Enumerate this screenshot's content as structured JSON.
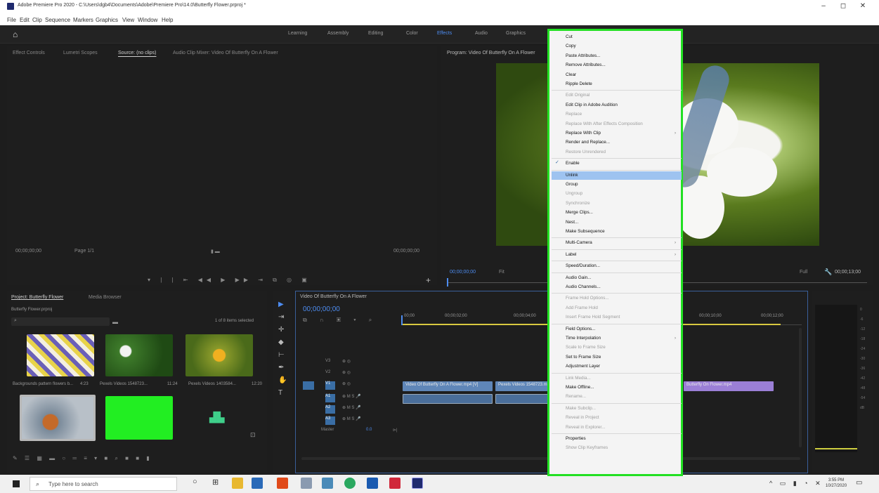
{
  "window": {
    "title": "Adobe Premiere Pro 2020 - C:\\Users\\dgb4\\Documents\\Adobe\\Premiere Pro\\14.0\\Butterfly Flower.prproj *",
    "minimize": "–",
    "maximize": "◻",
    "close": "✕"
  },
  "menubar": [
    "File",
    "Edit",
    "Clip",
    "Sequence",
    "Markers",
    "Graphics",
    "View",
    "Window",
    "Help"
  ],
  "workspaces": [
    "Learning",
    "Assembly",
    "Editing",
    "Color",
    "Effects",
    "Audio",
    "Graphics"
  ],
  "source_monitor": {
    "tabs": [
      "Effect Controls",
      "Lumetri Scopes",
      "Source: (no clips)",
      "Audio Clip Mixer: Video Of Butterfly On A Flower"
    ],
    "timecode_in": "00;00;00;00",
    "timecode_out": "00;00;00;00",
    "fit": "Page 1/1"
  },
  "program_monitor": {
    "title": "Program: Video Of Butterfly On A Flower",
    "timecode": "00;00;00;00",
    "duration": "00;00;13;00",
    "fit": "Fit",
    "zoom": "Full"
  },
  "project_panel": {
    "title": "Project: Butterfly Flower",
    "tab2": "Media Browser",
    "bin": "Butterfly Flower.prproj",
    "selection": "1 of 8 items selected",
    "items": [
      {
        "label": "Backgrounds pattern flowers b...",
        "duration": "4:23"
      },
      {
        "label": "Pexels Videos 1548723...",
        "duration": "11:24"
      },
      {
        "label": "Pexels Videos 1403584...",
        "duration": "12:20"
      }
    ]
  },
  "timeline": {
    "title": "Video Of Butterfly On A Flower",
    "timecode": "00;00;00;00",
    "ruler": [
      "00;00",
      "00;00;02;00",
      "00;00;04;00",
      "00;00;10;00",
      "00;00;12;00"
    ],
    "tracks": [
      "V3",
      "V2",
      "V1",
      "A1",
      "A2",
      "A3"
    ],
    "master": "Master",
    "master_value": "0.0",
    "clips": {
      "v1a": "Video Of Butterfly On A Flower.mp4 [V]",
      "v1b": "Pexels Videos 1548723.mp4",
      "v1c": "Butterfly On Flower.mp4"
    }
  },
  "context_menu": {
    "items": [
      {
        "label": "Cut",
        "state": "enabled"
      },
      {
        "label": "Copy",
        "state": "enabled"
      },
      {
        "label": "Paste Attributes...",
        "state": "enabled"
      },
      {
        "label": "Remove Attributes...",
        "state": "enabled"
      },
      {
        "label": "Clear",
        "state": "enabled"
      },
      {
        "label": "Ripple Delete",
        "state": "enabled"
      },
      {
        "label": "Edit Original",
        "state": "disabled"
      },
      {
        "label": "Edit Clip in Adobe Audition",
        "state": "enabled"
      },
      {
        "label": "Replace",
        "state": "disabled"
      },
      {
        "label": "Replace With After Effects Composition",
        "state": "disabled"
      },
      {
        "label": "Replace With Clip",
        "state": "enabled",
        "submenu": true
      },
      {
        "label": "Render and Replace...",
        "state": "enabled"
      },
      {
        "label": "Restore Unrendered",
        "state": "disabled"
      },
      {
        "label": "Enable",
        "state": "enabled",
        "checked": true
      },
      {
        "label": "Unlink",
        "state": "highlighted"
      },
      {
        "label": "Group",
        "state": "enabled"
      },
      {
        "label": "Ungroup",
        "state": "disabled"
      },
      {
        "label": "Synchronize",
        "state": "disabled"
      },
      {
        "label": "Merge Clips...",
        "state": "enabled"
      },
      {
        "label": "Nest...",
        "state": "enabled"
      },
      {
        "label": "Make Subsequence",
        "state": "enabled"
      },
      {
        "label": "Multi-Camera",
        "state": "enabled",
        "submenu": true
      },
      {
        "label": "Label",
        "state": "enabled",
        "submenu": true
      },
      {
        "label": "Speed/Duration...",
        "state": "enabled"
      },
      {
        "label": "Audio Gain...",
        "state": "enabled"
      },
      {
        "label": "Audio Channels...",
        "state": "enabled"
      },
      {
        "label": "Frame Hold Options...",
        "state": "disabled"
      },
      {
        "label": "Add Frame Hold",
        "state": "disabled"
      },
      {
        "label": "Insert Frame Hold Segment",
        "state": "disabled"
      },
      {
        "label": "Field Options...",
        "state": "enabled"
      },
      {
        "label": "Time Interpolation",
        "state": "enabled",
        "submenu": true
      },
      {
        "label": "Scale to Frame Size",
        "state": "disabled"
      },
      {
        "label": "Set to Frame Size",
        "state": "enabled"
      },
      {
        "label": "Adjustment Layer",
        "state": "enabled"
      },
      {
        "label": "Link Media...",
        "state": "disabled"
      },
      {
        "label": "Make Offline...",
        "state": "enabled"
      },
      {
        "label": "Rename...",
        "state": "disabled"
      },
      {
        "label": "Make Subclip...",
        "state": "disabled"
      },
      {
        "label": "Reveal in Project",
        "state": "disabled"
      },
      {
        "label": "Reveal in Explorer...",
        "state": "disabled"
      },
      {
        "label": "Properties",
        "state": "enabled"
      },
      {
        "label": "Show Clip Keyframes",
        "state": "disabled"
      }
    ]
  },
  "taskbar": {
    "search_placeholder": "Type here to search",
    "time": "3:55 PM",
    "date": "10/27/2020"
  },
  "colors": {
    "menu_highlight": "#9ec3f0",
    "menu_border": "#22e022",
    "accent_blue": "#4d8cf0",
    "clip_blue": "#5f86b8",
    "clip_purple": "#9b7fd6",
    "green_matte": "#22ee22"
  }
}
